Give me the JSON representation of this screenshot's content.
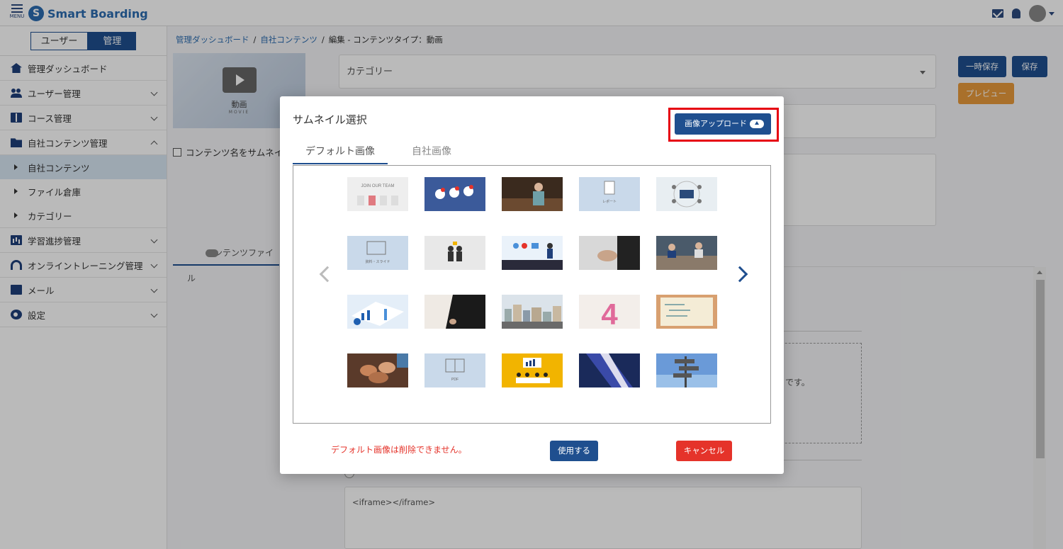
{
  "header": {
    "menu_label": "MENU",
    "logo_text": "Smart Boarding",
    "logo_mark": "S"
  },
  "sidebar": {
    "mode_user": "ユーザー",
    "mode_admin": "管理",
    "items": [
      {
        "label": "管理ダッシュボード",
        "icon": "home-icon"
      },
      {
        "label": "ユーザー管理",
        "icon": "users-icon"
      },
      {
        "label": "コース管理",
        "icon": "book-icon"
      },
      {
        "label": "自社コンテンツ管理",
        "icon": "folder-icon"
      },
      {
        "label": "学習進捗管理",
        "icon": "chart-icon"
      },
      {
        "label": "オンライントレーニング管理",
        "icon": "wifi-icon"
      },
      {
        "label": "メール",
        "icon": "mail-icon"
      },
      {
        "label": "設定",
        "icon": "gear-icon"
      }
    ],
    "sub_items": [
      {
        "label": "自社コンテンツ"
      },
      {
        "label": "ファイル倉庫"
      },
      {
        "label": "カテゴリー"
      }
    ]
  },
  "breadcrumb": {
    "crumb1": "管理ダッシュボード",
    "crumb2": "自社コンテンツ",
    "current": "編集 - コンテンツタイプ：動画",
    "sep": "/"
  },
  "main": {
    "video_label": "動画",
    "video_sub": "MOVIE",
    "category_placeholder": "カテゴリー",
    "btn_temp_save": "一時保存",
    "btn_save": "保存",
    "btn_preview": "プレビュー",
    "checkbox_label": "コンテンツ名をサムネイ",
    "content_file_tab": "コンテンツファイル",
    "bg_text_fragment": "」です。",
    "iframe_value": "<iframe></iframe>"
  },
  "modal": {
    "title": "サムネイル選択",
    "upload_label": "画像アップロード",
    "tab_default": "デフォルト画像",
    "tab_company": "自社画像",
    "footer_note": "デフォルト画像は削除できません。",
    "use_label": "使用する",
    "cancel_label": "キャンセル",
    "thumbnails": [
      {
        "name": "thumb-join-our-team",
        "text": "JOIN OUR TEAM"
      },
      {
        "name": "thumb-social-icons",
        "text": ""
      },
      {
        "name": "thumb-cafe-staff",
        "text": ""
      },
      {
        "name": "thumb-report",
        "text": "レポート"
      },
      {
        "name": "thumb-network",
        "text": ""
      },
      {
        "name": "thumb-slide",
        "text": "資料・スライド"
      },
      {
        "name": "thumb-leader",
        "text": ""
      },
      {
        "name": "thumb-presentation",
        "text": ""
      },
      {
        "name": "thumb-handshake",
        "text": ""
      },
      {
        "name": "thumb-meeting",
        "text": ""
      },
      {
        "name": "thumb-charts",
        "text": ""
      },
      {
        "name": "thumb-suit",
        "text": ""
      },
      {
        "name": "thumb-city",
        "text": ""
      },
      {
        "name": "thumb-number-four",
        "text": "4"
      },
      {
        "name": "thumb-mission-board",
        "text": ""
      },
      {
        "name": "thumb-teamwork-hands",
        "text": ""
      },
      {
        "name": "thumb-pdf",
        "text": "PDF"
      },
      {
        "name": "thumb-team-yellow",
        "text": ""
      },
      {
        "name": "thumb-tie",
        "text": ""
      },
      {
        "name": "thumb-signpost",
        "text": ""
      }
    ]
  },
  "colors": {
    "primary": "#1f4f8f",
    "danger": "#e5332a",
    "warning": "#e89a3c",
    "highlight": "#e60012",
    "link": "#2b6cb0"
  }
}
